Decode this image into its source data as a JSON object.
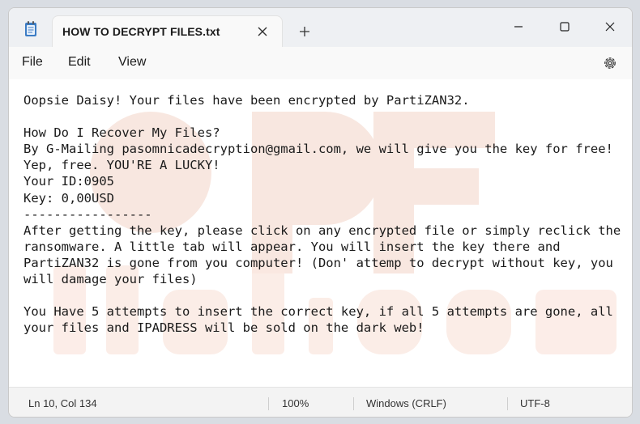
{
  "tab": {
    "title": "HOW TO DECRYPT FILES.txt"
  },
  "menu": {
    "file": "File",
    "edit": "Edit",
    "view": "View"
  },
  "editor": {
    "lines": [
      "Oopsie Daisy! Your files have been encrypted by PartiZAN32.",
      "",
      "How Do I Recover My Files?",
      "By G-Mailing pasomnicadecryption@gmail.com, we will give you the key for free!",
      "Yep, free. YOU'RE A LUCKY!",
      "Your ID:0905",
      "Key: 0,00USD",
      "-----------------",
      "After getting the key, please click on any encrypted file or simply reclick the",
      "ransomware. A little tab will appear. You will insert the key there and",
      "PartiZAN32 is gone from you computer! (Don' attemp to decrypt without key, you",
      "will damage your files)",
      "",
      "You Have 5 attempts to insert the correct key, if all 5 attempts are gone, all",
      "your files and IPADRESS will be sold on the dark web!"
    ],
    "watermark_text": "risk.com"
  },
  "status": {
    "position": "Ln 10, Col 134",
    "zoom": "100%",
    "line_endings": "Windows (CRLF)",
    "encoding": "UTF-8"
  },
  "colors": {
    "titlebar": "#eef0f3",
    "editor_bg": "#ffffff",
    "text": "#1a1a1a",
    "watermark": "#f5d9cf"
  },
  "icons": {
    "app": "notepad-icon",
    "tab_close": "close-icon",
    "new_tab": "plus-icon",
    "minimize": "minimize-icon",
    "maximize": "maximize-icon",
    "close": "close-icon",
    "settings": "gear-icon"
  }
}
